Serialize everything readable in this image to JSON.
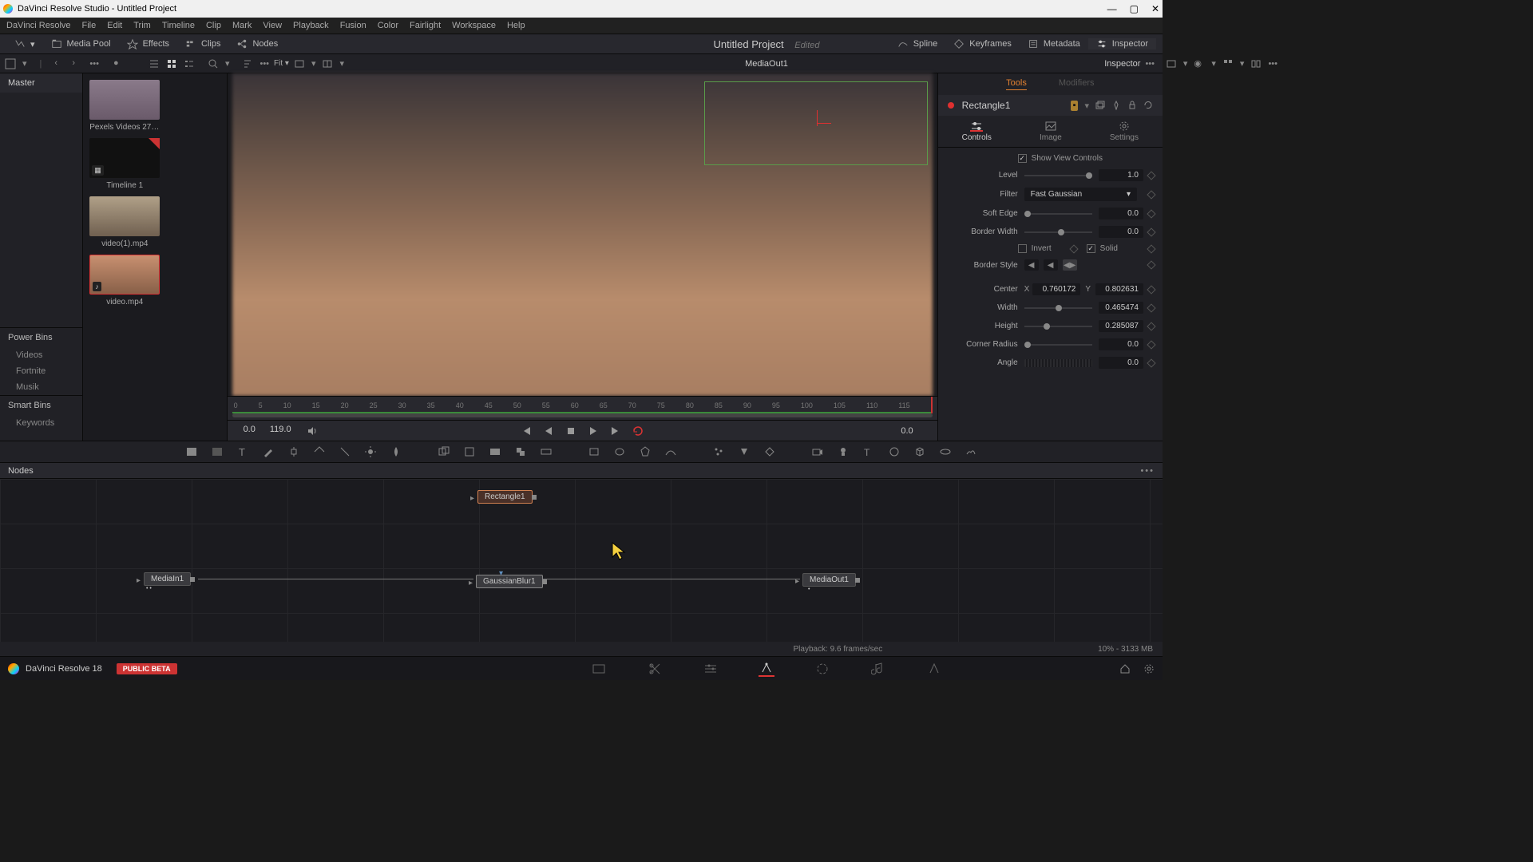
{
  "titlebar": {
    "title": "DaVinci Resolve Studio - Untitled Project"
  },
  "menu": [
    "DaVinci Resolve",
    "File",
    "Edit",
    "Trim",
    "Timeline",
    "Clip",
    "Mark",
    "View",
    "Playback",
    "Fusion",
    "Color",
    "Fairlight",
    "Workspace",
    "Help"
  ],
  "toptoolbar": {
    "media_pool": "Media Pool",
    "effects": "Effects",
    "clips": "Clips",
    "nodes": "Nodes",
    "project": "Untitled Project",
    "edited": "Edited",
    "spline": "Spline",
    "keyframes": "Keyframes",
    "metadata": "Metadata",
    "inspector": "Inspector"
  },
  "subtoolbar": {
    "fit": "Fit ▾",
    "mediaout": "MediaOut1",
    "inspector": "Inspector"
  },
  "leftpanel": {
    "master": "Master",
    "powerbins": "Power Bins",
    "items": [
      "Videos",
      "Fortnite",
      "Musik"
    ],
    "smartbins": "Smart Bins",
    "keywords": "Keywords"
  },
  "thumbs": [
    {
      "label": "Pexels Videos 278..."
    },
    {
      "label": "Timeline 1"
    },
    {
      "label": "video(1).mp4"
    },
    {
      "label": "video.mp4"
    }
  ],
  "timeline": {
    "ticks": [
      "0",
      "5",
      "10",
      "15",
      "20",
      "25",
      "30",
      "35",
      "40",
      "45",
      "50",
      "55",
      "60",
      "65",
      "70",
      "75",
      "80",
      "85",
      "90",
      "95",
      "100",
      "105",
      "110",
      "115"
    ]
  },
  "transport": {
    "start": "0.0",
    "end": "119.0",
    "current": "0.0"
  },
  "inspector": {
    "tabs": {
      "tools": "Tools",
      "modifiers": "Modifiers"
    },
    "node_name": "Rectangle1",
    "subtabs": {
      "controls": "Controls",
      "image": "Image",
      "settings": "Settings"
    },
    "show_view_controls": "Show View Controls",
    "level": {
      "label": "Level",
      "value": "1.0"
    },
    "filter": {
      "label": "Filter",
      "value": "Fast Gaussian"
    },
    "soft_edge": {
      "label": "Soft Edge",
      "value": "0.0"
    },
    "border_width": {
      "label": "Border Width",
      "value": "0.0"
    },
    "invert": "Invert",
    "solid": "Solid",
    "border_style": "Border Style",
    "center": {
      "label": "Center",
      "x": "0.760172",
      "y": "0.802631"
    },
    "width": {
      "label": "Width",
      "value": "0.465474"
    },
    "height": {
      "label": "Height",
      "value": "0.285087"
    },
    "corner_radius": {
      "label": "Corner Radius",
      "value": "0.0"
    },
    "angle": {
      "label": "Angle",
      "value": "0.0"
    }
  },
  "nodes_panel": {
    "title": "Nodes"
  },
  "nodes": {
    "mediain": "MediaIn1",
    "gaussian": "GaussianBlur1",
    "rectangle": "Rectangle1",
    "mediaout": "MediaOut1"
  },
  "status": {
    "playback": "Playback: 9.6 frames/sec",
    "zoom_mem": "10% - 3133 MB"
  },
  "pagebar": {
    "app": "DaVinci Resolve 18",
    "beta": "PUBLIC BETA"
  }
}
